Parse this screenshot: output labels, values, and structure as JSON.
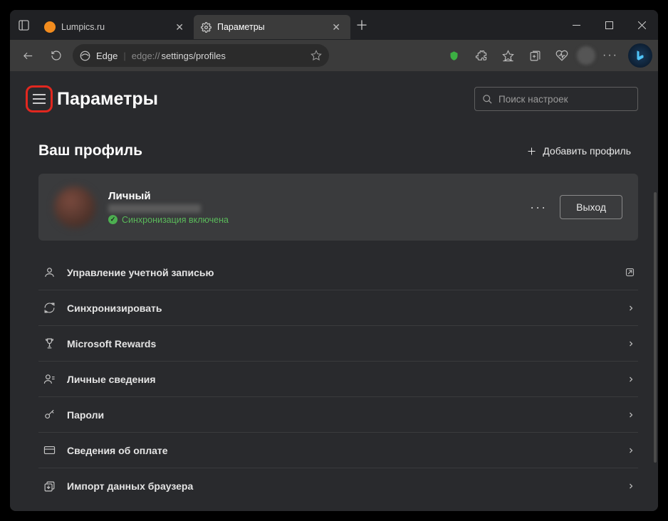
{
  "titlebar": {
    "tabs": [
      {
        "label": "Lumpics.ru",
        "favicon_color": "#f28c1e",
        "active": false
      },
      {
        "label": "Параметры",
        "favicon": "gear",
        "active": true
      }
    ]
  },
  "toolbar": {
    "brand": "Edge",
    "url_scheme": "edge://",
    "url_path": "settings/profiles"
  },
  "page": {
    "title": "Параметры",
    "search_placeholder": "Поиск настроек"
  },
  "profile_section": {
    "title": "Ваш профиль",
    "add_label": "Добавить профиль",
    "card": {
      "name": "Личный",
      "sync_status": "Синхронизация включена",
      "logout": "Выход"
    },
    "items": [
      {
        "icon": "user",
        "label": "Управление учетной записью",
        "arrow": "external"
      },
      {
        "icon": "sync",
        "label": "Синхронизировать",
        "arrow": "chevron"
      },
      {
        "icon": "trophy",
        "label": "Microsoft Rewards",
        "arrow": "chevron"
      },
      {
        "icon": "person",
        "label": "Личные сведения",
        "arrow": "chevron"
      },
      {
        "icon": "key",
        "label": "Пароли",
        "arrow": "chevron"
      },
      {
        "icon": "card",
        "label": "Сведения об оплате",
        "arrow": "chevron"
      },
      {
        "icon": "import",
        "label": "Импорт данных браузера",
        "arrow": "chevron"
      }
    ]
  }
}
